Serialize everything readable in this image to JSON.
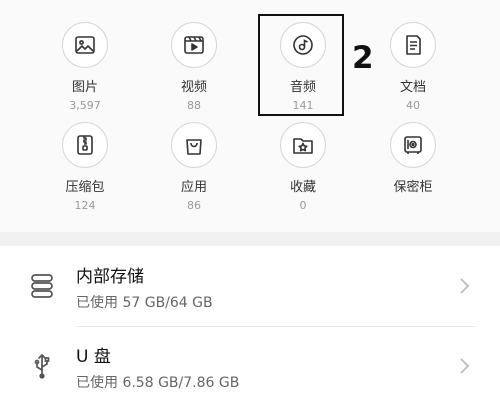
{
  "categories": [
    {
      "label": "图片",
      "count": "3,597",
      "icon": "image-icon"
    },
    {
      "label": "视频",
      "count": "88",
      "icon": "video-icon"
    },
    {
      "label": "音频",
      "count": "141",
      "icon": "music-icon"
    },
    {
      "label": "文档",
      "count": "40",
      "icon": "document-icon"
    },
    {
      "label": "压缩包",
      "count": "124",
      "icon": "zip-icon"
    },
    {
      "label": "应用",
      "count": "86",
      "icon": "shopping-bag-icon"
    },
    {
      "label": "收藏",
      "count": "0",
      "icon": "star-folder-icon"
    },
    {
      "label": "保密柜",
      "count": "",
      "icon": "safe-icon"
    }
  ],
  "annotation": {
    "number": "2"
  },
  "storage": [
    {
      "title": "内部存储",
      "usage": "已使用 57 GB/64 GB",
      "icon": "internal-storage-icon"
    },
    {
      "title": "U 盘",
      "usage": "已使用 6.58 GB/7.86 GB",
      "icon": "usb-icon"
    }
  ],
  "colors": {
    "icon_stroke": "#333333",
    "accent_border": "#111111",
    "background": "#fafafa"
  }
}
